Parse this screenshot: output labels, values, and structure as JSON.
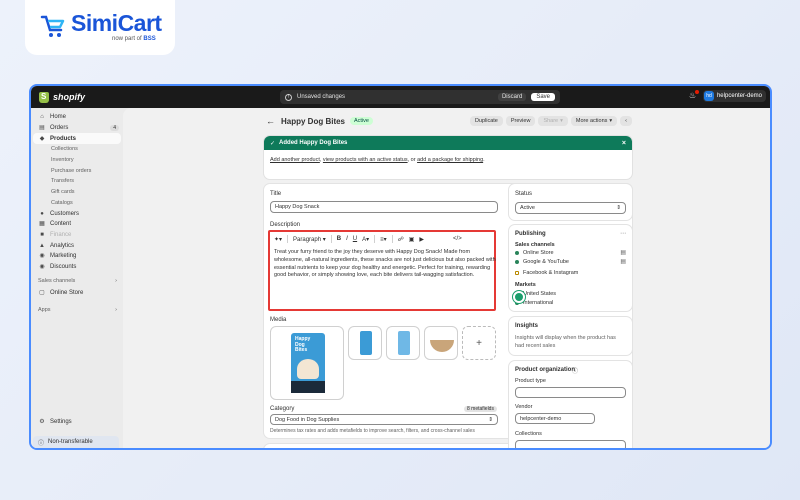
{
  "logo": {
    "name": "SimiCart",
    "sub_prefix": "now part of",
    "sub_brand": "BSS"
  },
  "topbar": {
    "brand": "shopify",
    "unsaved": "Unsaved changes",
    "discard": "Discard",
    "save": "Save",
    "store_initials": "hd",
    "store_name": "helpcenter-demo"
  },
  "sidebar": {
    "items": [
      {
        "label": "Home",
        "icon": "home-icon"
      },
      {
        "label": "Orders",
        "icon": "orders-icon",
        "badge": "4"
      },
      {
        "label": "Products",
        "icon": "tag-icon",
        "active": true
      },
      {
        "label": "Collections",
        "sub": true
      },
      {
        "label": "Inventory",
        "sub": true
      },
      {
        "label": "Purchase orders",
        "sub": true
      },
      {
        "label": "Transfers",
        "sub": true
      },
      {
        "label": "Gift cards",
        "sub": true
      },
      {
        "label": "Catalogs",
        "sub": true
      },
      {
        "label": "Customers",
        "icon": "person-icon"
      },
      {
        "label": "Content",
        "icon": "content-icon"
      },
      {
        "label": "Finance",
        "icon": "finance-icon",
        "dim": true
      },
      {
        "label": "Analytics",
        "icon": "analytics-icon"
      },
      {
        "label": "Marketing",
        "icon": "marketing-icon"
      },
      {
        "label": "Discounts",
        "icon": "discount-icon"
      }
    ],
    "sales_channels": "Sales channels",
    "online_store": "Online Store",
    "apps": "Apps",
    "settings": "Settings",
    "non_transferable": "Non-transferable"
  },
  "page": {
    "title": "Happy Dog Bites",
    "status": "Active",
    "actions": [
      "Duplicate",
      "Preview",
      "Share",
      "More actions"
    ]
  },
  "banner": {
    "title": "Added Happy Dog Bites",
    "link1": "Add another product",
    "link2": "view products with an active status",
    "mid": ", or ",
    "link3": "add a package for shipping",
    "comma": ", ",
    "end": "."
  },
  "product": {
    "title_label": "Title",
    "title_value": "Happy Dog Snack",
    "description_label": "Description",
    "paragraph": "Paragraph",
    "description_lines": [
      "Treat your furry friend to the joy they deserve with Happy Dog Snack! Made from",
      "wholesome, all-natural ingredients, these snacks are not just delicious but also packed with",
      "essential nutrients to keep your dog healthy and energetic. Perfect for training, rewarding",
      "good behavior, or simply showing love, each bite delivers tail-wagging satisfaction."
    ],
    "media_label": "Media",
    "package_text": [
      "Happy",
      "Dog",
      "Bites"
    ],
    "category_label": "Category",
    "metafields": "8 metafields",
    "category_value": "Dog Food in Dog Supplies",
    "category_help": "Determines tax rates and adds metafields to improve search, filters, and cross-channel sales"
  },
  "right": {
    "status_label": "Status",
    "status_value": "Active",
    "publishing": "Publishing",
    "sales_channels": "Sales channels",
    "channels": [
      "Online Store",
      "Google & YouTube",
      "Facebook & Instagram"
    ],
    "markets": "Markets",
    "market_items": [
      "United States",
      "International"
    ],
    "insights_title": "Insights",
    "insights_text": [
      "Insights will display when the product has",
      "had recent sales"
    ],
    "org_title": "Product organization",
    "product_type": "Product type",
    "vendor": "Vendor",
    "vendor_value": "helpcenter-demo",
    "collections": "Collections"
  },
  "colors": {
    "accent": "#1a55d8",
    "banner": "#0e7a5a",
    "highlight": "#e53935",
    "frame": "#4a8cff"
  }
}
